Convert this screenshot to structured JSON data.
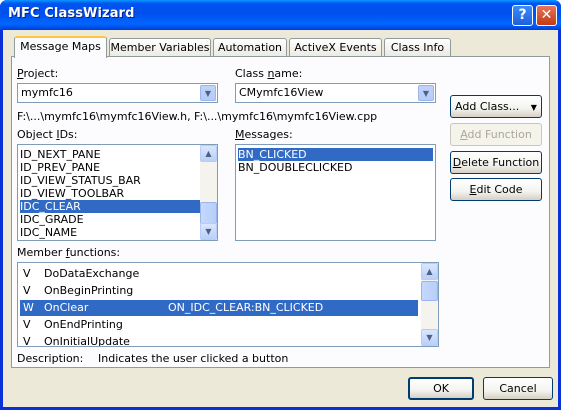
{
  "window": {
    "title": "MFC ClassWizard",
    "help_glyph": "?",
    "close_glyph": "✕"
  },
  "tabs": [
    {
      "label": "Message Maps",
      "active": true
    },
    {
      "label": "Member Variables",
      "active": false
    },
    {
      "label": "Automation",
      "active": false
    },
    {
      "label": "ActiveX Events",
      "active": false
    },
    {
      "label": "Class Info",
      "active": false
    }
  ],
  "project": {
    "label_pre": "",
    "label_u": "P",
    "label_post": "roject:",
    "value": "mymfc16"
  },
  "class_name": {
    "label_pre": "Class ",
    "label_u": "n",
    "label_post": "ame:",
    "value": "CMymfc16View"
  },
  "file_path": "F:\\...\\mymfc16\\mymfc16View.h, F:\\...\\mymfc16\\mymfc16View.cpp",
  "object_ids": {
    "label_pre": "Object ",
    "label_u": "I",
    "label_post": "Ds:",
    "items": [
      "ID_NEXT_PANE",
      "ID_PREV_PANE",
      "ID_VIEW_STATUS_BAR",
      "ID_VIEW_TOOLBAR",
      "IDC_CLEAR",
      "IDC_GRADE",
      "IDC_NAME"
    ],
    "selected_index": 4
  },
  "messages": {
    "label_pre": "",
    "label_u": "M",
    "label_post": "essages:",
    "items": [
      "BN_CLICKED",
      "BN_DOUBLECLICKED"
    ],
    "selected_index": 0
  },
  "member_functions": {
    "label_pre": "Member ",
    "label_u": "f",
    "label_post": "unctions:",
    "rows": [
      {
        "type": "V",
        "name": "DoDataExchange",
        "message": ""
      },
      {
        "type": "V",
        "name": "OnBeginPrinting",
        "message": ""
      },
      {
        "type": "W",
        "name": "OnClear",
        "message": "ON_IDC_CLEAR:BN_CLICKED"
      },
      {
        "type": "V",
        "name": "OnEndPrinting",
        "message": ""
      },
      {
        "type": "V",
        "name": "OnInitialUpdate",
        "message": ""
      }
    ],
    "selected_index": 2
  },
  "description": {
    "label": "Description:",
    "text": "Indicates the user clicked a button"
  },
  "side_buttons": {
    "add_class": "Add Class...",
    "add_class_arrow": "▼",
    "add_function_pre": "",
    "add_function_u": "A",
    "add_function_post": "dd Function",
    "delete_function_pre": "",
    "delete_function_u": "D",
    "delete_function_post": "elete Function",
    "edit_code_pre": "",
    "edit_code_u": "E",
    "edit_code_post": "dit Code"
  },
  "footer": {
    "ok": "OK",
    "cancel": "Cancel"
  },
  "icons": {
    "combo_arrow": "▼",
    "scroll_up": "▲",
    "scroll_down": "▼"
  },
  "colors": {
    "selection": "#316ac5",
    "title_bar": "#0054e3",
    "dialog_face": "#ece9d8"
  }
}
